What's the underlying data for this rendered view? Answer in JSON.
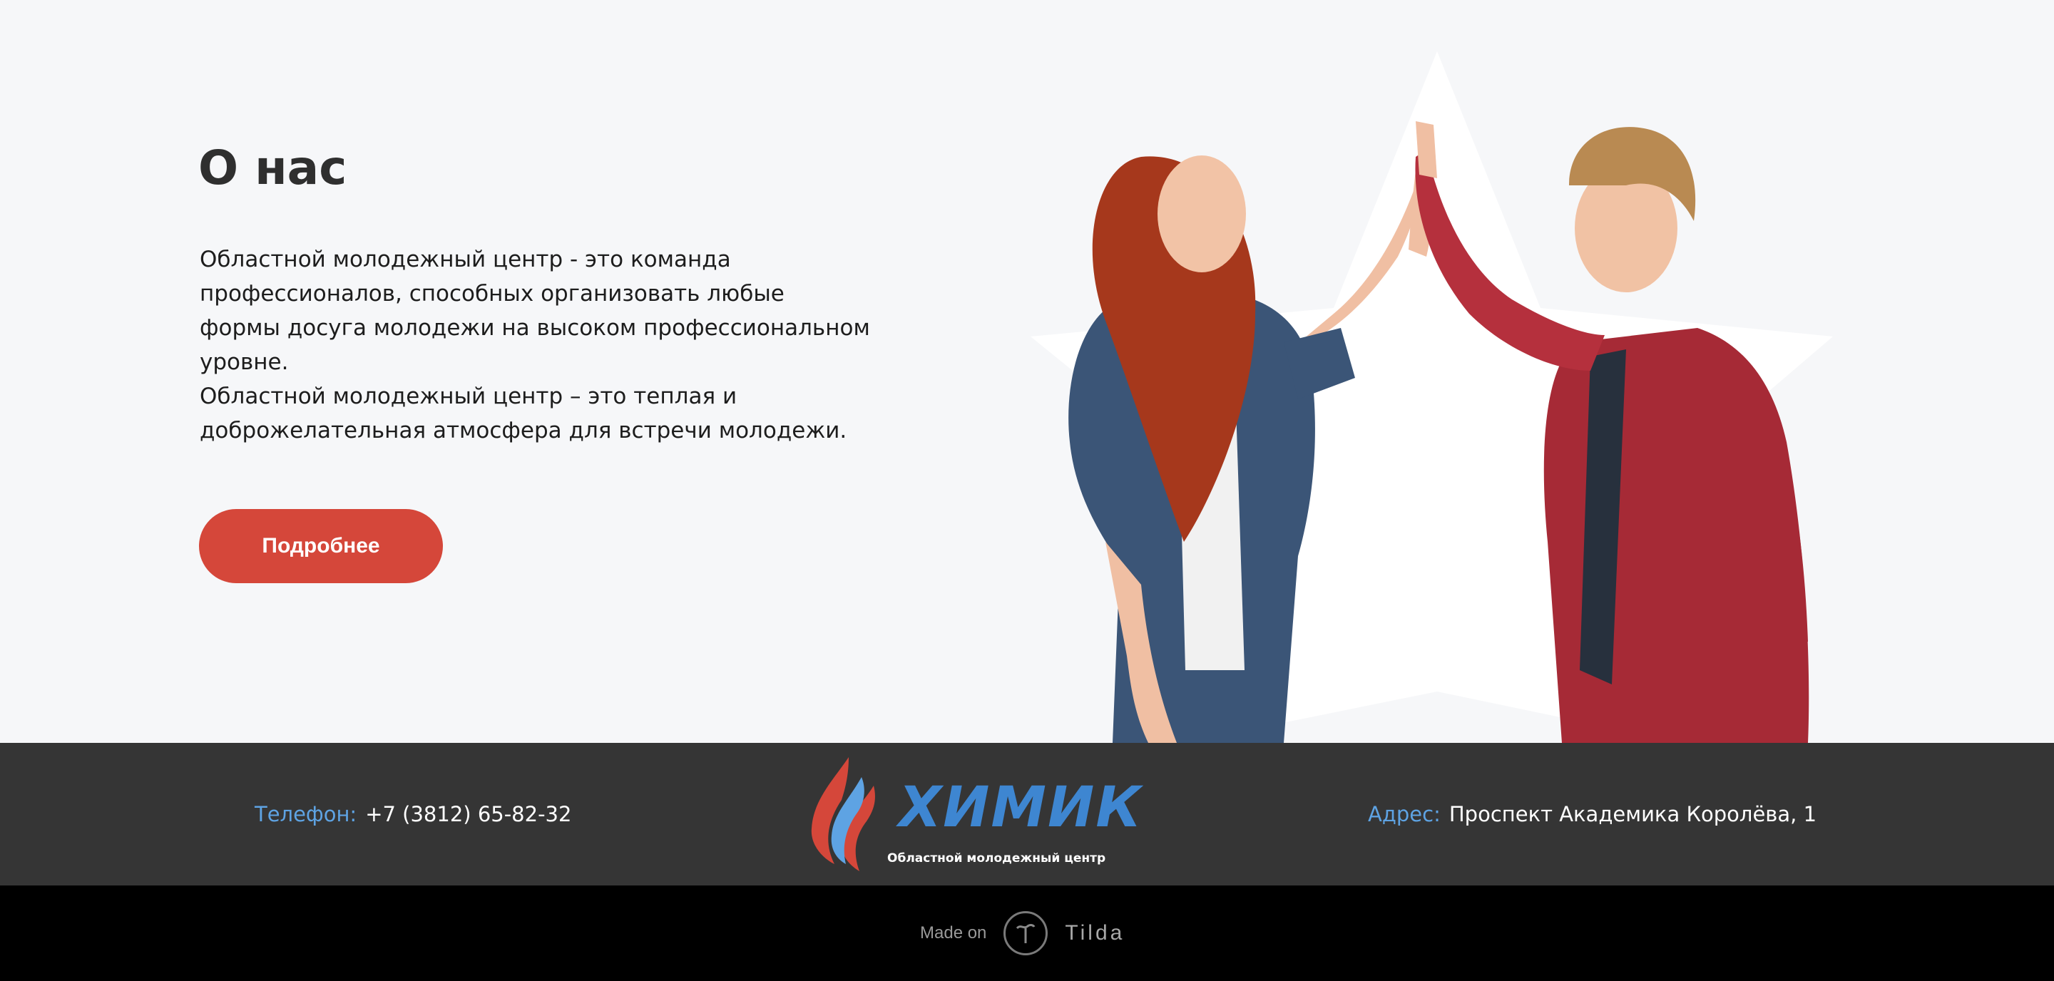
{
  "about": {
    "title": "О нас",
    "paragraph1": "Областной молодежный центр - это команда профессионалов, способных организовать любые формы досуга молодежи на высоком профессиональном уровне.",
    "paragraph2": "Областной молодежный центр – это теплая и доброжелательная атмосфера для встречи молодежи.",
    "button_label": "Подробнее"
  },
  "footer": {
    "phone_label": "Телефон:",
    "phone_value": "+7 (3812) 65-82-32",
    "address_label": "Адрес:",
    "address_value": "Проспект Академика Королёва, 1",
    "logo_word": "ХИМИК",
    "logo_subtitle": "Областной молодежный центр"
  },
  "made_on": {
    "label": "Made on",
    "brand": "Tilda"
  },
  "colors": {
    "accent_button": "#d5473a",
    "label_blue": "#5ea3e3",
    "footer_bg": "#353535",
    "page_bg": "#f6f7f9"
  },
  "icons": [
    "logo-flame-icon",
    "tilda-logo-icon"
  ]
}
